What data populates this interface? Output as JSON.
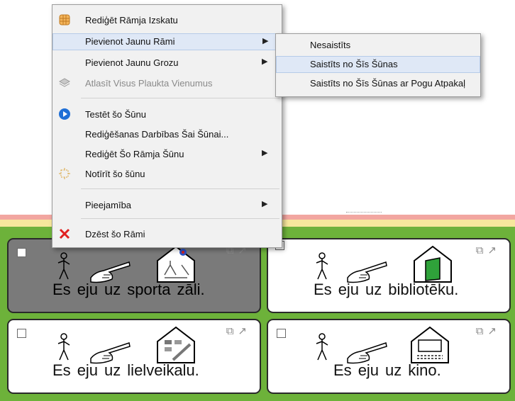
{
  "colors": {
    "grid_green": "#6db23a",
    "stripe_red": "#f2a6a0",
    "stripe_yellow": "#f7e79c",
    "selected_cell": "#7a7a7a",
    "menu_highlight": "#dfe8f6",
    "delete_red": "#e02020",
    "test_blue": "#1f6fd6"
  },
  "context_menu": {
    "items": [
      {
        "label": "Rediģēt Rāmja Izskatu",
        "icon": "grid-frame-icon"
      },
      {
        "label": "Pievienot Jaunu Rāmi",
        "has_submenu": true,
        "highlighted": true
      },
      {
        "label": "Pievienot Jaunu Grozu",
        "has_submenu": true
      },
      {
        "label": "Atlasīt Visus Plaukta Vienumus",
        "icon": "stack-icon",
        "disabled": true
      },
      {
        "label": "Testēt šo Šūnu",
        "icon": "play-icon"
      },
      {
        "label": "Rediģēšanas Darbības Šai Šūnai...",
        "icon": ""
      },
      {
        "label": "Rediģēt Šo Rāmja Šūnu",
        "has_submenu": true
      },
      {
        "label": "Notīrīt šo šūnu",
        "icon": "clear-icon"
      },
      {
        "label": "Pieejamība",
        "has_submenu": true
      },
      {
        "label": "Dzēst šo Rāmi",
        "icon": "delete-icon"
      }
    ],
    "arrow": "▶"
  },
  "submenu": {
    "items": [
      {
        "label": "Nesaistīts"
      },
      {
        "label": "Saistīts no Šīs Šūnas",
        "highlighted": true
      },
      {
        "label": "Saistīts no Šīs Šūnas ar Pogu Atpakaļ"
      }
    ]
  },
  "cell_icons": "⧉↗",
  "cells": [
    {
      "words": [
        "Es",
        "eju",
        "uz",
        "sporta",
        "zāli."
      ],
      "selected": true,
      "place_icon": "gym-icon"
    },
    {
      "words": [
        "Es",
        "eju",
        "uz",
        "bibliotēku."
      ],
      "selected": false,
      "place_icon": "library-icon"
    },
    {
      "words": [
        "Es",
        "eju",
        "uz",
        "lielveikalu."
      ],
      "selected": false,
      "place_icon": "supermarket-icon"
    },
    {
      "words": [
        "Es",
        "eju",
        "uz",
        "kino."
      ],
      "selected": false,
      "place_icon": "cinema-icon"
    }
  ]
}
